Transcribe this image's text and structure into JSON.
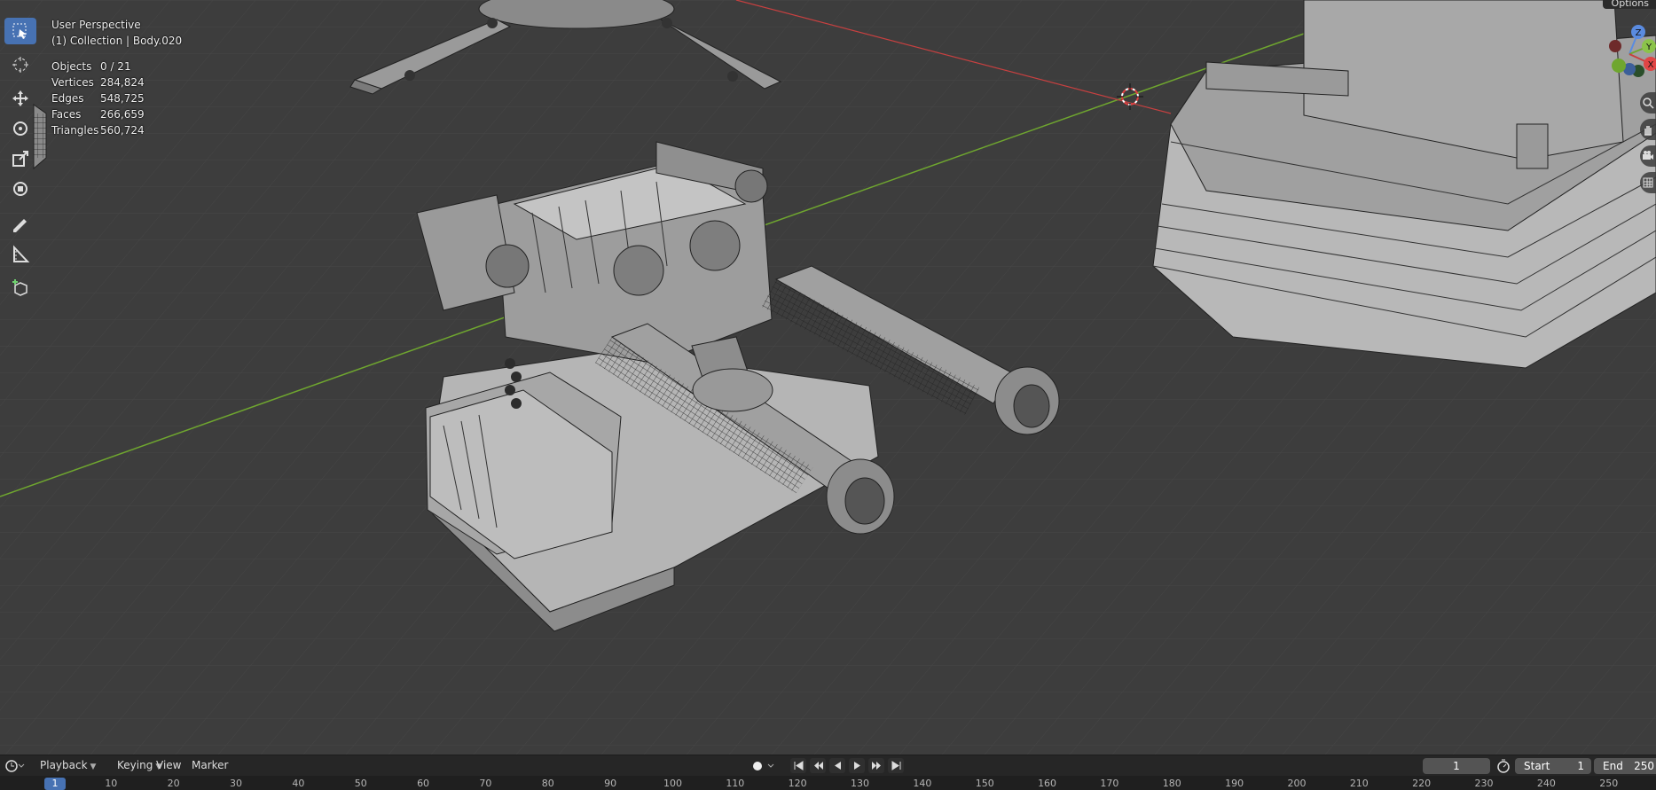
{
  "viewport": {
    "title": "User Perspective",
    "collection": "(1) Collection | Body.020",
    "options_label": "Options",
    "stats": [
      {
        "label": "Objects",
        "value": "0 / 21"
      },
      {
        "label": "Vertices",
        "value": "284,824"
      },
      {
        "label": "Edges",
        "value": "548,725"
      },
      {
        "label": "Faces",
        "value": "266,659"
      },
      {
        "label": "Triangles",
        "value": "560,724"
      }
    ],
    "gizmo_axes": [
      "Z",
      "Y",
      "X"
    ]
  },
  "toolbar": {
    "tools": [
      "select-box-tool",
      "cursor-tool",
      "move-tool",
      "rotate-tool",
      "scale-tool",
      "transform-tool",
      "annotate-tool",
      "measure-tool",
      "add-cube-tool"
    ]
  },
  "timeline": {
    "menus": {
      "playback": "Playback",
      "keying": "Keying",
      "view": "View",
      "marker": "Marker"
    },
    "current_frame": "1",
    "start_label": "Start",
    "start_value": "1",
    "end_label": "End",
    "end_value": "250",
    "ruler_ticks": [
      "1",
      "10",
      "20",
      "30",
      "40",
      "50",
      "60",
      "70",
      "80",
      "90",
      "100",
      "110",
      "120",
      "130",
      "140",
      "150",
      "160",
      "170",
      "180",
      "190",
      "200",
      "210",
      "220",
      "230",
      "240",
      "250"
    ]
  },
  "colors": {
    "accent": "#4772b3",
    "viewport_bg": "#3d3d3d",
    "x_axis": "#c74040",
    "y_axis": "#6fa62f"
  }
}
